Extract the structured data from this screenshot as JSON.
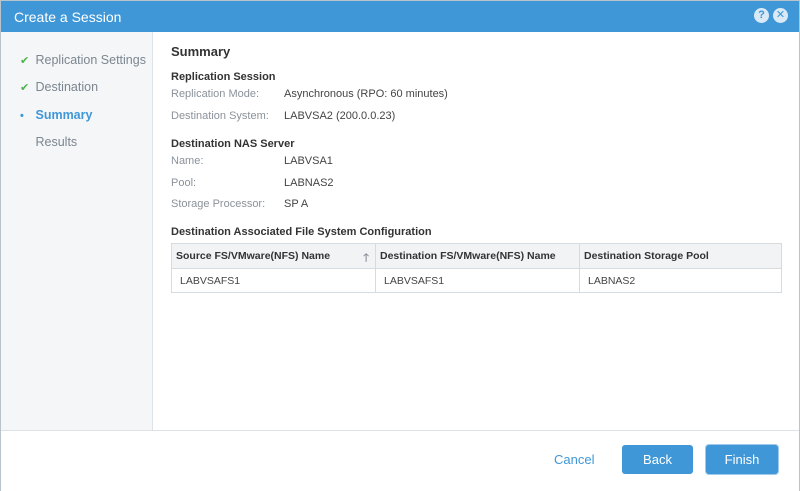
{
  "window": {
    "title": "Create a Session",
    "help_glyph": "?",
    "close_glyph": "✕"
  },
  "steps": [
    {
      "label": "Replication Settings",
      "state": "done",
      "marker": "✔"
    },
    {
      "label": "Destination",
      "state": "done",
      "marker": "✔"
    },
    {
      "label": "Summary",
      "state": "active",
      "marker": "•"
    },
    {
      "label": "Results",
      "state": "pending",
      "marker": ""
    }
  ],
  "summary": {
    "heading": "Summary",
    "replication_session": {
      "heading": "Replication Session",
      "mode_label": "Replication Mode:",
      "mode_value": "Asynchronous (RPO: 60 minutes)",
      "dest_system_label": "Destination System:",
      "dest_system_value": "LABVSA2 (200.0.0.23)"
    },
    "destination_nas": {
      "heading": "Destination NAS Server",
      "name_label": "Name:",
      "name_value": "LABVSA1",
      "pool_label": "Pool:",
      "pool_value": "LABNAS2",
      "sp_label": "Storage Processor:",
      "sp_value": "SP A"
    },
    "fs_config": {
      "heading": "Destination Associated File System Configuration",
      "columns": [
        "Source FS/VMware(NFS) Name",
        "Destination FS/VMware(NFS) Name",
        "Destination Storage Pool"
      ],
      "rows": [
        [
          "LABVSAFS1",
          "LABVSAFS1",
          "LABNAS2"
        ]
      ]
    }
  },
  "footer": {
    "cancel_label": "Cancel",
    "back_label": "Back",
    "finish_label": "Finish"
  },
  "colors": {
    "accent": "#3f97d7",
    "check": "#4eb14e"
  }
}
